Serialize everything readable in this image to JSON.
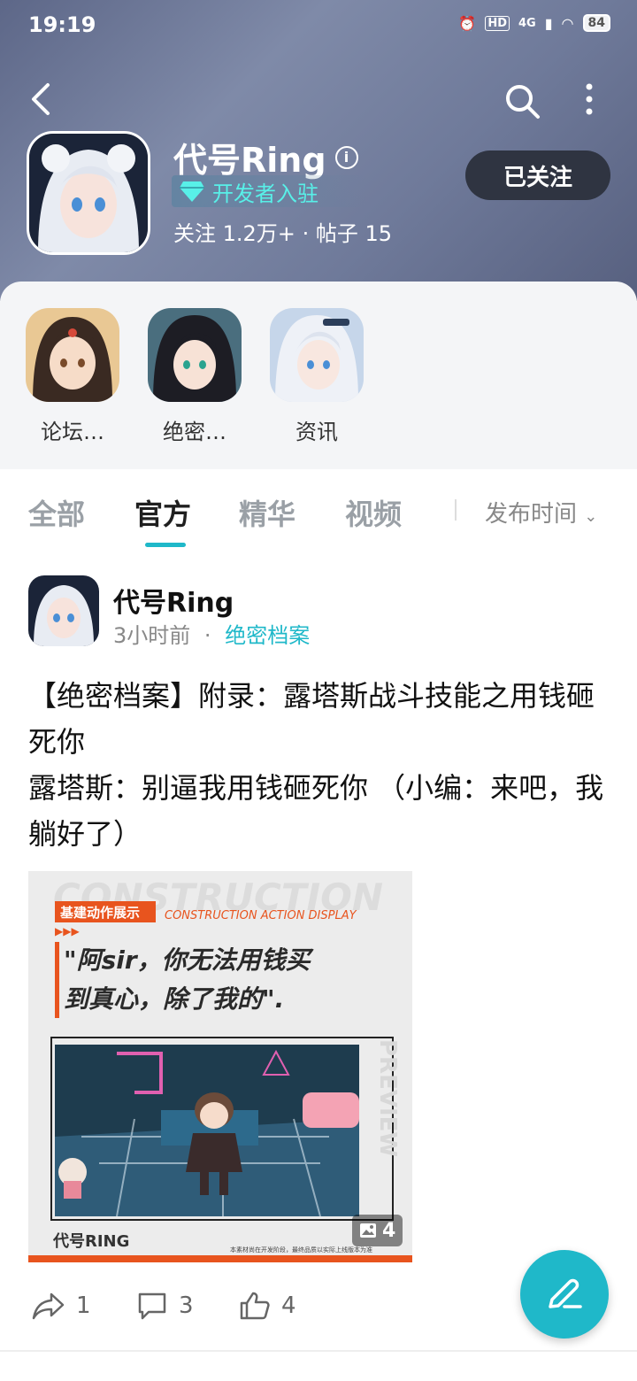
{
  "status_bar": {
    "time": "19:19",
    "battery": "84",
    "network": "4G",
    "hd": "HD"
  },
  "header": {
    "title": "代号Ring",
    "developer_tag": "开发者入驻",
    "follow_label": "关注",
    "follow_count": "1.2万+",
    "separator": "·",
    "posts_label": "帖子",
    "posts_count": "15",
    "follow_button": "已关注"
  },
  "quick_links": [
    {
      "label": "论坛…"
    },
    {
      "label": "绝密…"
    },
    {
      "label": "资讯"
    }
  ],
  "tabs": [
    {
      "label": "全部",
      "active": false
    },
    {
      "label": "官方",
      "active": true
    },
    {
      "label": "精华",
      "active": false
    },
    {
      "label": "视频",
      "active": false
    }
  ],
  "sort": {
    "label": "发布时间"
  },
  "post": {
    "author": "代号Ring",
    "time": "3小时前",
    "dot": "·",
    "topic": "绝密档案",
    "text_line1": "【绝密档案】附录：露塔斯战斗技能之用钱砸死你",
    "text_line2": "露塔斯：别逼我用钱砸死你 （小编：来吧，我躺好了）",
    "image": {
      "banner_big": "CONSTRUCTION",
      "banner_tag": "基建动作展示",
      "banner_en": "CONSTRUCTION ACTION DISPLAY",
      "quote_line1": "\"阿sir，你无法用钱买",
      "quote_line2": "到真心，除了我的\".",
      "preview": "PREVIEW",
      "logo": "代号RING",
      "footnote": "本素材尚在开发阶段，最终品质以实际上线版本为准",
      "count": "4"
    },
    "shares": "1",
    "comments": "3",
    "likes": "4"
  },
  "colors": {
    "accent": "#1fb8c9",
    "follow_button_bg": "#2f3441",
    "header_bg": "#6f7a9a"
  }
}
